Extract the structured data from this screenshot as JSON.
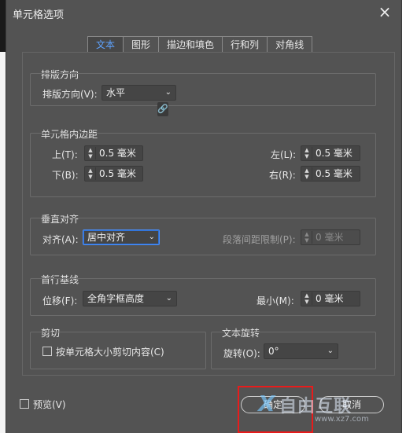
{
  "dialog": {
    "title": "单元格选项",
    "close_glyph": "×"
  },
  "tabs": [
    "文本",
    "图形",
    "描边和填色",
    "行和列",
    "对角线"
  ],
  "orientation": {
    "group_title": "排版方向",
    "label": "排版方向(V):",
    "value": "水平"
  },
  "insets": {
    "group_title": "单元格内边距",
    "top_label": "上(T):",
    "top_value": "0.5 毫米",
    "bottom_label": "下(B):",
    "bottom_value": "0.5 毫米",
    "left_label": "左(L):",
    "left_value": "0.5 毫米",
    "right_label": "右(R):",
    "right_value": "0.5 毫米",
    "link_glyph": "🔗"
  },
  "vertical_justification": {
    "group_title": "垂直对齐",
    "align_label": "对齐(A):",
    "align_value": "居中对齐",
    "para_spacing_label": "段落间距限制(P):",
    "para_spacing_value": "0 毫米"
  },
  "first_baseline": {
    "group_title": "首行基线",
    "offset_label": "位移(F):",
    "offset_value": "全角字框高度",
    "min_label": "最小(M):",
    "min_value": "0 毫米"
  },
  "clipping": {
    "group_title": "剪切",
    "checkbox_label": "按单元格大小剪切内容(C)"
  },
  "text_rotation": {
    "group_title": "文本旋转",
    "label": "旋转(O):",
    "value": "0°"
  },
  "footer": {
    "preview_label": "预览(V)",
    "ok_label": "确定",
    "cancel_label": "取消"
  },
  "watermark": {
    "text": "自由互联",
    "url": "www.xz7.com",
    "logo": "X"
  },
  "colors": {
    "dialog_bg": "#535353",
    "active_tab": "#5ea3ff",
    "highlight": "#e81b1b",
    "focus": "#4a90ff"
  }
}
